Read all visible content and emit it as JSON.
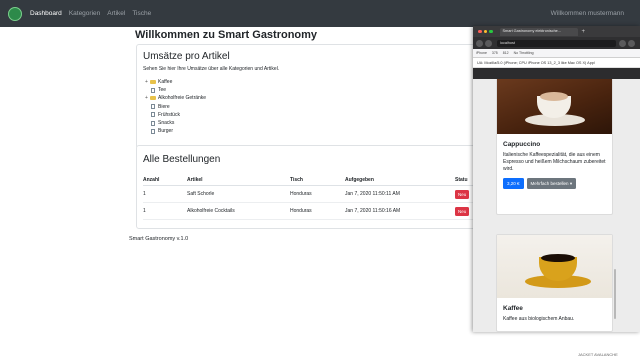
{
  "nav": {
    "items": [
      "Dashboard",
      "Kategorien",
      "Artikel",
      "Tische"
    ],
    "user": "Willkommen mustermann"
  },
  "page": {
    "title": "Willkommen zu Smart Gastronomy"
  },
  "umsaetze": {
    "title": "Umsätze pro Artikel",
    "subtitle": "Sehen Sie hier Ihre Umsätze über alle Kategorien und Artikel.",
    "tree": [
      {
        "label": "Kaffee",
        "type": "folder"
      },
      {
        "label": "Tee",
        "type": "file"
      },
      {
        "label": "Alkoholfreie Getränke",
        "type": "folder"
      },
      {
        "label": "Biere",
        "type": "file"
      },
      {
        "label": "Frühstück",
        "type": "file"
      },
      {
        "label": "Snacks",
        "type": "file"
      },
      {
        "label": "Burger",
        "type": "file"
      }
    ]
  },
  "orders": {
    "title": "Alle Bestellungen",
    "headers": [
      "Anzahl",
      "Artikel",
      "Tisch",
      "Aufgegeben",
      "Statu"
    ],
    "rows": [
      {
        "anzahl": "1",
        "artikel": "Saft Schorle",
        "tisch": "Honduras",
        "aufgegeben": "Jan 7, 2020 11:50:11 AM",
        "status": "Neu"
      },
      {
        "anzahl": "1",
        "artikel": "Alkoholfreie Cocktails",
        "tisch": "Honduras",
        "aufgegeben": "Jan 7, 2020 11:50:16 AM",
        "status": "Neu"
      }
    ]
  },
  "footer": {
    "text": "Smart Gastronomy v.1.0"
  },
  "browser": {
    "tab_title": "Smart Gastronomy elektronische...",
    "url": "localhost",
    "devbar": [
      "iPhone",
      "375",
      "812",
      "No Throttling"
    ],
    "ua": "UA: Mozilla/5.0 (iPhone; CPU iPhone OS 13_2_3 like Mac OS X) Appl",
    "cards": [
      {
        "title": "Cappuccino",
        "desc": "Italienische Kaffeespezialität, die aus einem Espresso und heißem Milchschaum zubereitet wird.",
        "price": "3,20 €",
        "multi": "Mehrfach bestellen"
      },
      {
        "title": "Kaffee",
        "desc": "Kaffee aus biologischem Anbau."
      }
    ]
  },
  "watermark": "JACKET AVALANCHE",
  "colors": {
    "navbar": "#343a40",
    "badge": "#dc3545",
    "primary": "#0d6efd",
    "secondary": "#6c757d"
  }
}
